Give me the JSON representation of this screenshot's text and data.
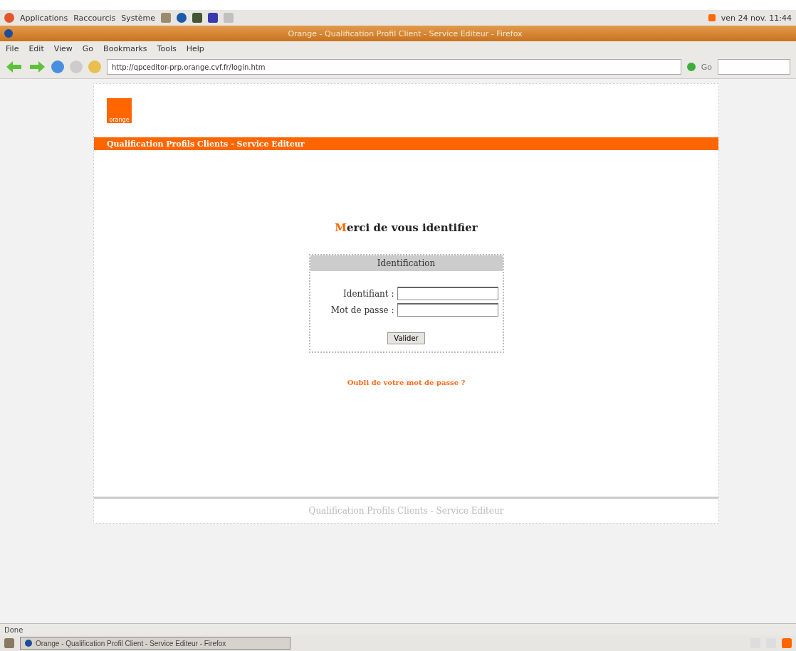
{
  "panel": {
    "menus": [
      "Applications",
      "Raccourcis",
      "Système"
    ],
    "clock": "ven 24 nov. 11:44"
  },
  "window": {
    "title": "Orange - Qualification Profil Client - Service Editeur - Firefox"
  },
  "menubar": [
    "File",
    "Edit",
    "View",
    "Go",
    "Bookmarks",
    "Tools",
    "Help"
  ],
  "toolbar": {
    "url": "http://qpceditor-prp.orange.cvf.fr/login.htm",
    "go": "Go"
  },
  "page": {
    "logo": "orange",
    "banner": "Qualification Profils Clients - Service Editeur",
    "heading_initial": "M",
    "heading_rest": "erci de vous identifier",
    "login": {
      "title": "Identification",
      "fields": [
        {
          "label": "Identifiant :"
        },
        {
          "label": "Mot de passe :"
        }
      ],
      "submit": "Valider"
    },
    "forgot": "Oubli de votre mot de passe ?",
    "footer": "Qualification Profils Clients - Service Editeur"
  },
  "status_bar": {
    "text": "Done"
  },
  "taskbar": {
    "tasks": [
      {
        "label": "Orange - Qualification Profil Client - Service Editeur - Firefox",
        "selected": true
      }
    ]
  }
}
